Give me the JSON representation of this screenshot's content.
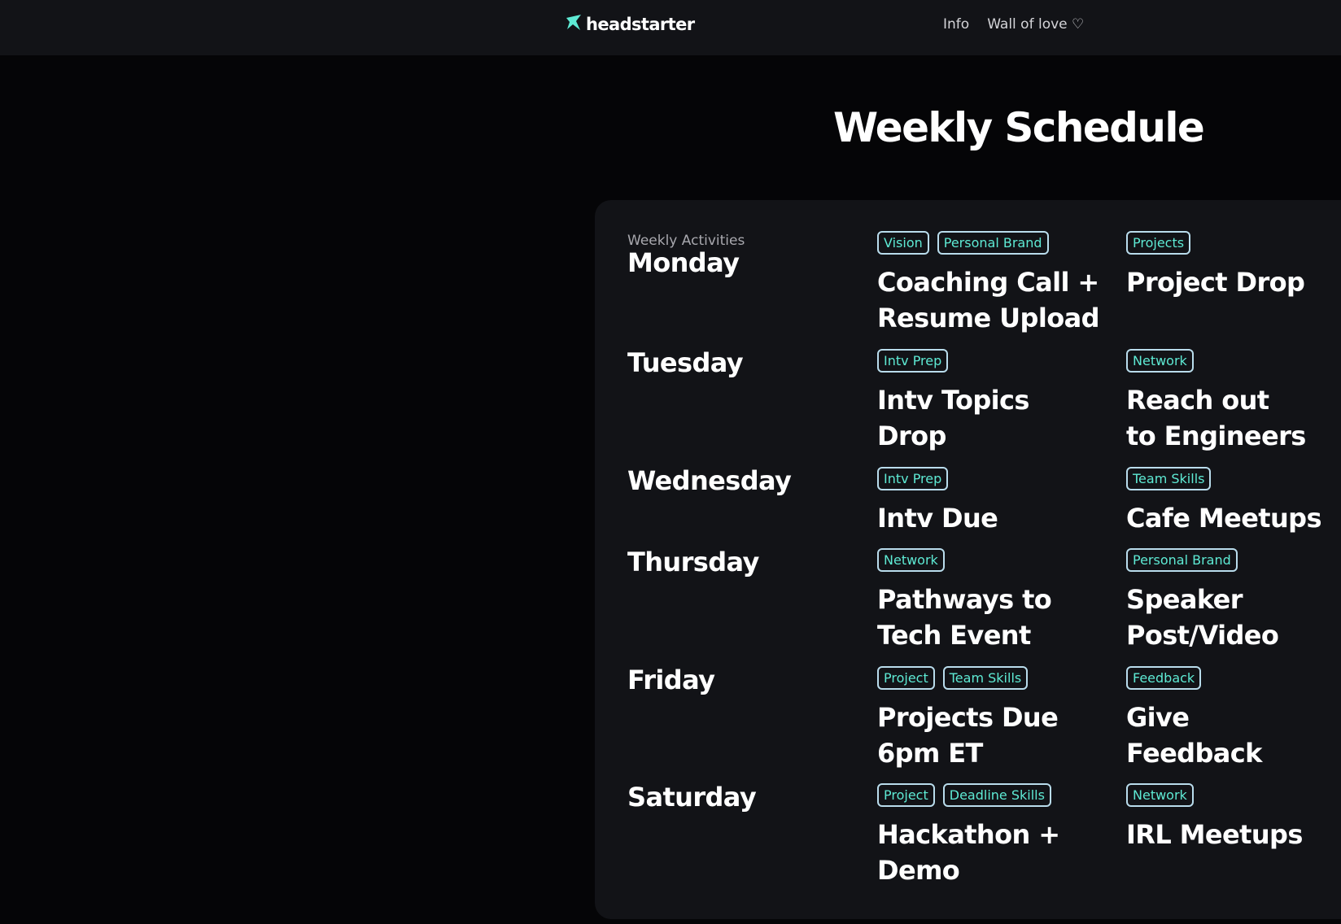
{
  "brand": {
    "name": "headstarter",
    "accent_color": "#5eead4",
    "icon": "star-logo-icon"
  },
  "nav": {
    "info_label": "Info",
    "wall_label": "Wall of love ♡"
  },
  "page": {
    "title": "Weekly Schedule"
  },
  "schedule": {
    "section_label": "Weekly Activities",
    "days": [
      {
        "name": "Monday",
        "activities": [
          {
            "tags": [
              "Vision",
              "Personal Brand"
            ],
            "title": "Coaching Call +\nResume Upload"
          },
          {
            "tags": [
              "Projects"
            ],
            "title": "Project Drop"
          }
        ]
      },
      {
        "name": "Tuesday",
        "activities": [
          {
            "tags": [
              "Intv Prep"
            ],
            "title": "Intv Topics\nDrop"
          },
          {
            "tags": [
              "Network"
            ],
            "title": "Reach out\nto Engineers"
          }
        ]
      },
      {
        "name": "Wednesday",
        "activities": [
          {
            "tags": [
              "Intv Prep"
            ],
            "title": "Intv  Due"
          },
          {
            "tags": [
              "Team Skills"
            ],
            "title": "Cafe Meetups"
          }
        ]
      },
      {
        "name": "Thursday",
        "activities": [
          {
            "tags": [
              "Network"
            ],
            "title": "Pathways to\nTech Event"
          },
          {
            "tags": [
              "Personal Brand"
            ],
            "title": "Speaker\nPost/Video"
          }
        ]
      },
      {
        "name": "Friday",
        "activities": [
          {
            "tags": [
              "Project",
              "Team Skills"
            ],
            "title": "Projects Due\n6pm ET"
          },
          {
            "tags": [
              "Feedback"
            ],
            "title": "Give\nFeedback"
          }
        ]
      },
      {
        "name": "Saturday",
        "activities": [
          {
            "tags": [
              "Project",
              "Deadline Skills"
            ],
            "title": "Hackathon +\nDemo"
          },
          {
            "tags": [
              "Network"
            ],
            "title": "IRL Meetups"
          }
        ]
      }
    ]
  }
}
